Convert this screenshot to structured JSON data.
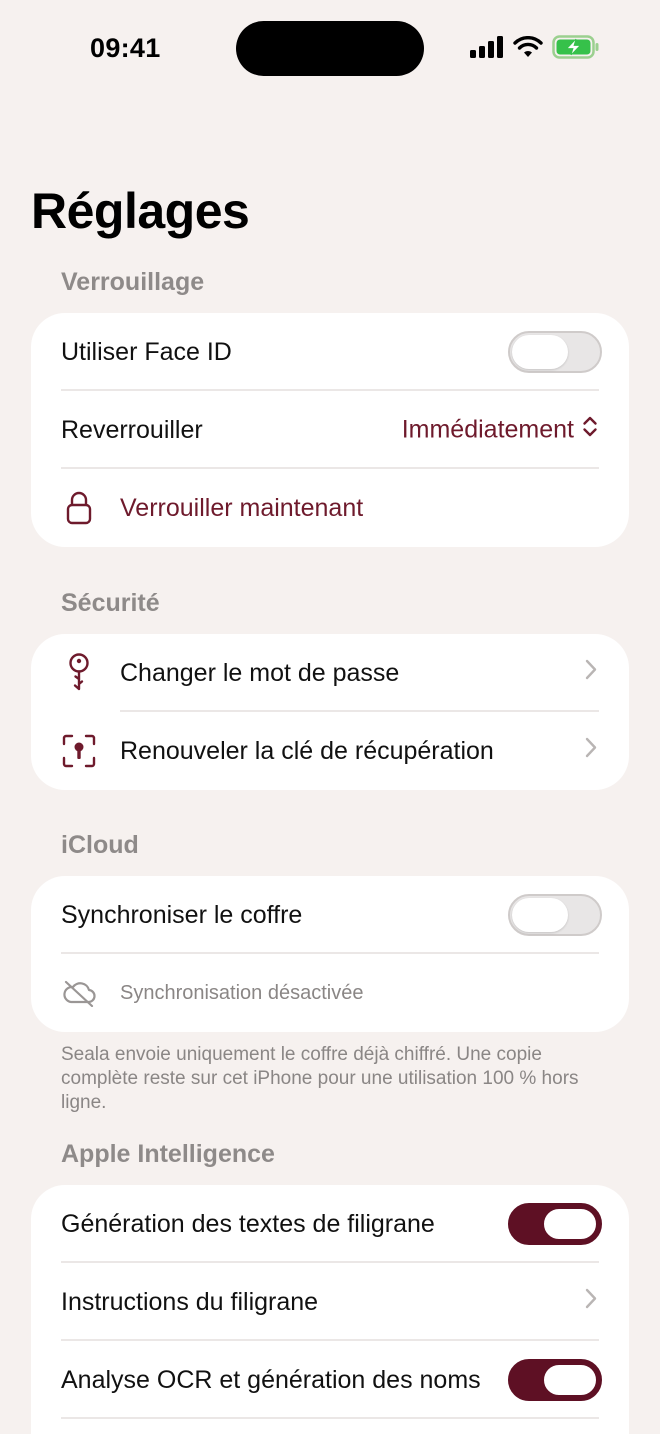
{
  "status_bar": {
    "time": "09:41"
  },
  "page_title": "Réglages",
  "sections": {
    "lock": {
      "header": "Verrouillage",
      "face_id_label": "Utiliser Face ID",
      "face_id_enabled": false,
      "relock_label": "Reverrouiller",
      "relock_value": "Immédiatement",
      "lock_now_label": "Verrouiller maintenant"
    },
    "security": {
      "header": "Sécurité",
      "change_password_label": "Changer le mot de passe",
      "renew_key_label": "Renouveler la clé de récupération"
    },
    "icloud": {
      "header": "iCloud",
      "sync_label": "Synchroniser le coffre",
      "sync_enabled": false,
      "sync_status": "Synchronisation désactivée",
      "footnote": "Seala envoie uniquement le coffre déjà chiffré. Une copie complète reste sur cet iPhone pour une utilisation 100 % hors ligne."
    },
    "apple_intelligence": {
      "header": "Apple Intelligence",
      "watermark_gen_label": "Génération des textes de filigrane",
      "watermark_gen_enabled": true,
      "watermark_instructions_label": "Instructions du filigrane",
      "ocr_label": "Analyse OCR et génération des noms",
      "ocr_enabled": true
    }
  },
  "colors": {
    "accent": "#6e1a2c",
    "background": "#f6f1ef",
    "toggle_on": "#5e1024"
  },
  "icons": [
    "lock-icon",
    "key-icon",
    "scan-key-icon",
    "cloud-off-icon",
    "chevron-right-icon",
    "up-down-chevron-icon",
    "signal-icon",
    "wifi-icon",
    "battery-charging-icon"
  ]
}
